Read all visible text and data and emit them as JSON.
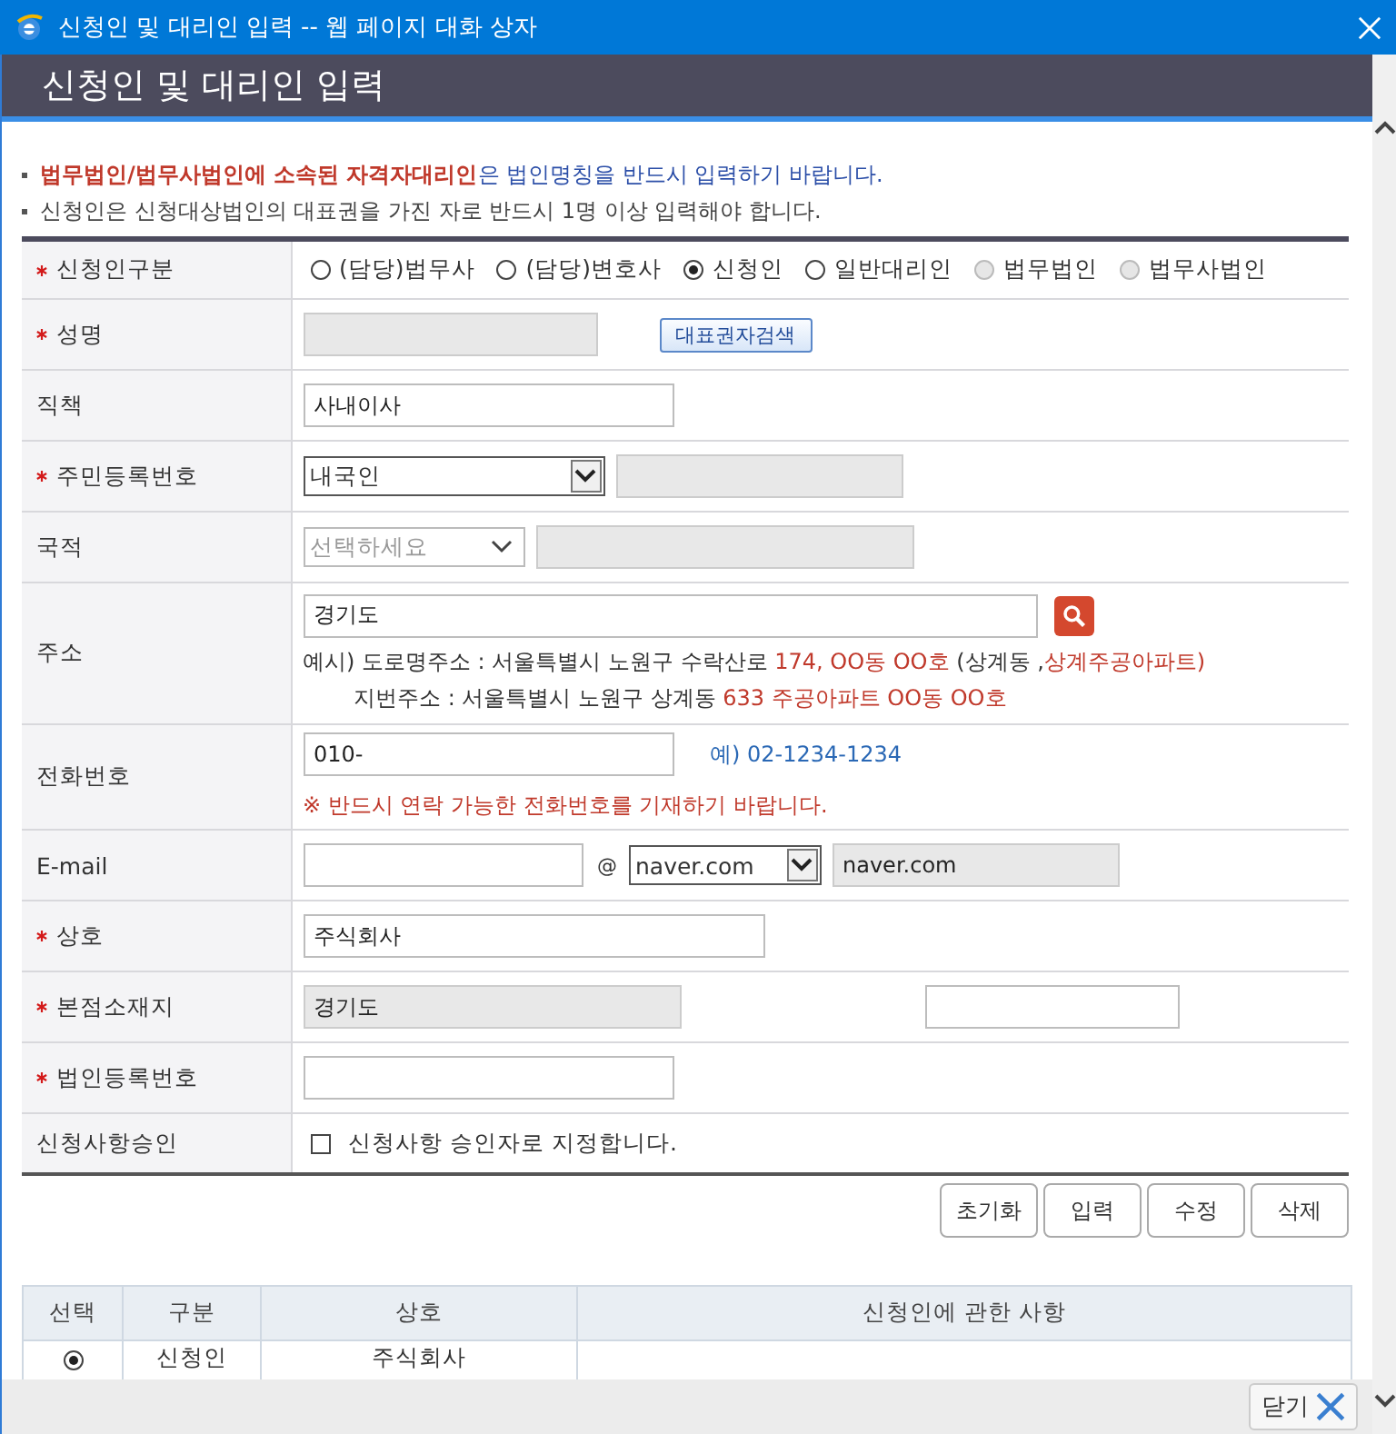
{
  "window": {
    "title": "신청인 및 대리인 입력 -- 웹 페이지 대화 상자"
  },
  "header": {
    "title": "신청인 및 대리인 입력"
  },
  "notices": [
    {
      "highlight": "법무법인/법무사법인에 소속된 자격자대리인",
      "text": "은 법인명칭을 반드시 입력하기 바랍니다."
    },
    {
      "text": "신청인은 신청대상법인의 대표권을 가진 자로 반드시 1명 이상 입력해야 합니다."
    }
  ],
  "form": [
    {
      "kind": "radio",
      "label": "신청인구분",
      "required": true,
      "options": [
        {
          "label": "(담당)법무사",
          "selected": false,
          "disabled": false
        },
        {
          "label": "(담당)변호사",
          "selected": false,
          "disabled": false
        },
        {
          "label": "신청인",
          "selected": true,
          "disabled": false
        },
        {
          "label": "일반대리인",
          "selected": false,
          "disabled": false
        },
        {
          "label": "법무법인",
          "selected": false,
          "disabled": true
        },
        {
          "label": "법무사법인",
          "selected": false,
          "disabled": true
        }
      ]
    },
    {
      "kind": "search",
      "label": "성명",
      "required": true,
      "button": "대표권자검색"
    },
    {
      "kind": "text",
      "label": "직책",
      "required": false,
      "value": "사내이사"
    },
    {
      "kind": "id",
      "label": "주민등록번호",
      "required": true,
      "select": "내국인"
    },
    {
      "kind": "nationality",
      "label": "국적",
      "required": false,
      "placeholder": "선택하세요"
    },
    {
      "kind": "address",
      "label": "주소",
      "required": false,
      "value": "경기도",
      "examples": [
        [
          {
            "text": "예시) 도로명주소 : 서울특별시 노원구 수락산로 ",
            "highlight": false
          },
          {
            "text": "174, OO동 OO호",
            "highlight": true
          },
          {
            "text": " (상계동 ,",
            "highlight": false
          },
          {
            "text": "상계주공아파트)",
            "highlight": true
          }
        ],
        [
          {
            "text": "지번주소 : 서울특별시 노원구 상계동 ",
            "highlight": false
          },
          {
            "text": "633 주공아파트 OO동 OO호",
            "highlight": true
          }
        ]
      ]
    },
    {
      "kind": "phone",
      "label": "전화번호",
      "required": false,
      "value": "010-",
      "hint": "예) 02-1234-1234",
      "warning": "※ 반드시 연락 가능한 전화번호를 기재하기 바랍니다."
    },
    {
      "kind": "email",
      "label": "E-mail",
      "required": false,
      "at": "@",
      "select": "naver.com",
      "domain": "naver.com"
    },
    {
      "kind": "text",
      "label": "상호",
      "required": true,
      "value": "주식회사"
    },
    {
      "kind": "hq",
      "label": "본점소재지",
      "required": true,
      "value": "경기도"
    },
    {
      "kind": "text",
      "label": "법인등록번호",
      "required": true
    },
    {
      "kind": "checkbox",
      "label": "신청사항승인",
      "required": false,
      "checked": false,
      "text": "신청사항 승인자로 지정합니다."
    }
  ],
  "buttons": [
    "초기화",
    "입력",
    "수정",
    "삭제"
  ],
  "results": {
    "columns": [
      "선택",
      "구분",
      "상호",
      "신청인에 관한 사항"
    ],
    "rows": [
      {
        "selected": true,
        "cells": [
          "",
          "신청인",
          "주식회사"
        ]
      }
    ]
  },
  "footer": {
    "close": "닫기"
  }
}
